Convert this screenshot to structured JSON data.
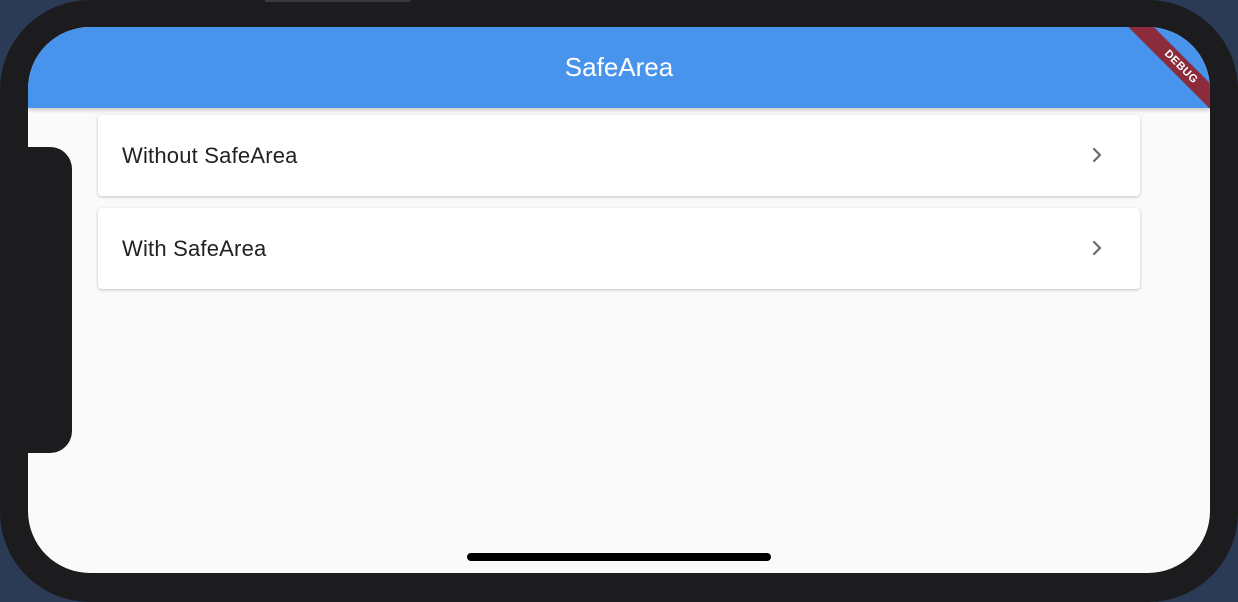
{
  "app_bar": {
    "title": "SafeArea",
    "background": "#4893ec"
  },
  "debug_banner": {
    "label": "DEBUG",
    "color": "#8b2b3c"
  },
  "list": {
    "items": [
      {
        "label": "Without SafeArea",
        "icon": "chevron-right-icon"
      },
      {
        "label": "With SafeArea",
        "icon": "chevron-right-icon"
      }
    ]
  }
}
